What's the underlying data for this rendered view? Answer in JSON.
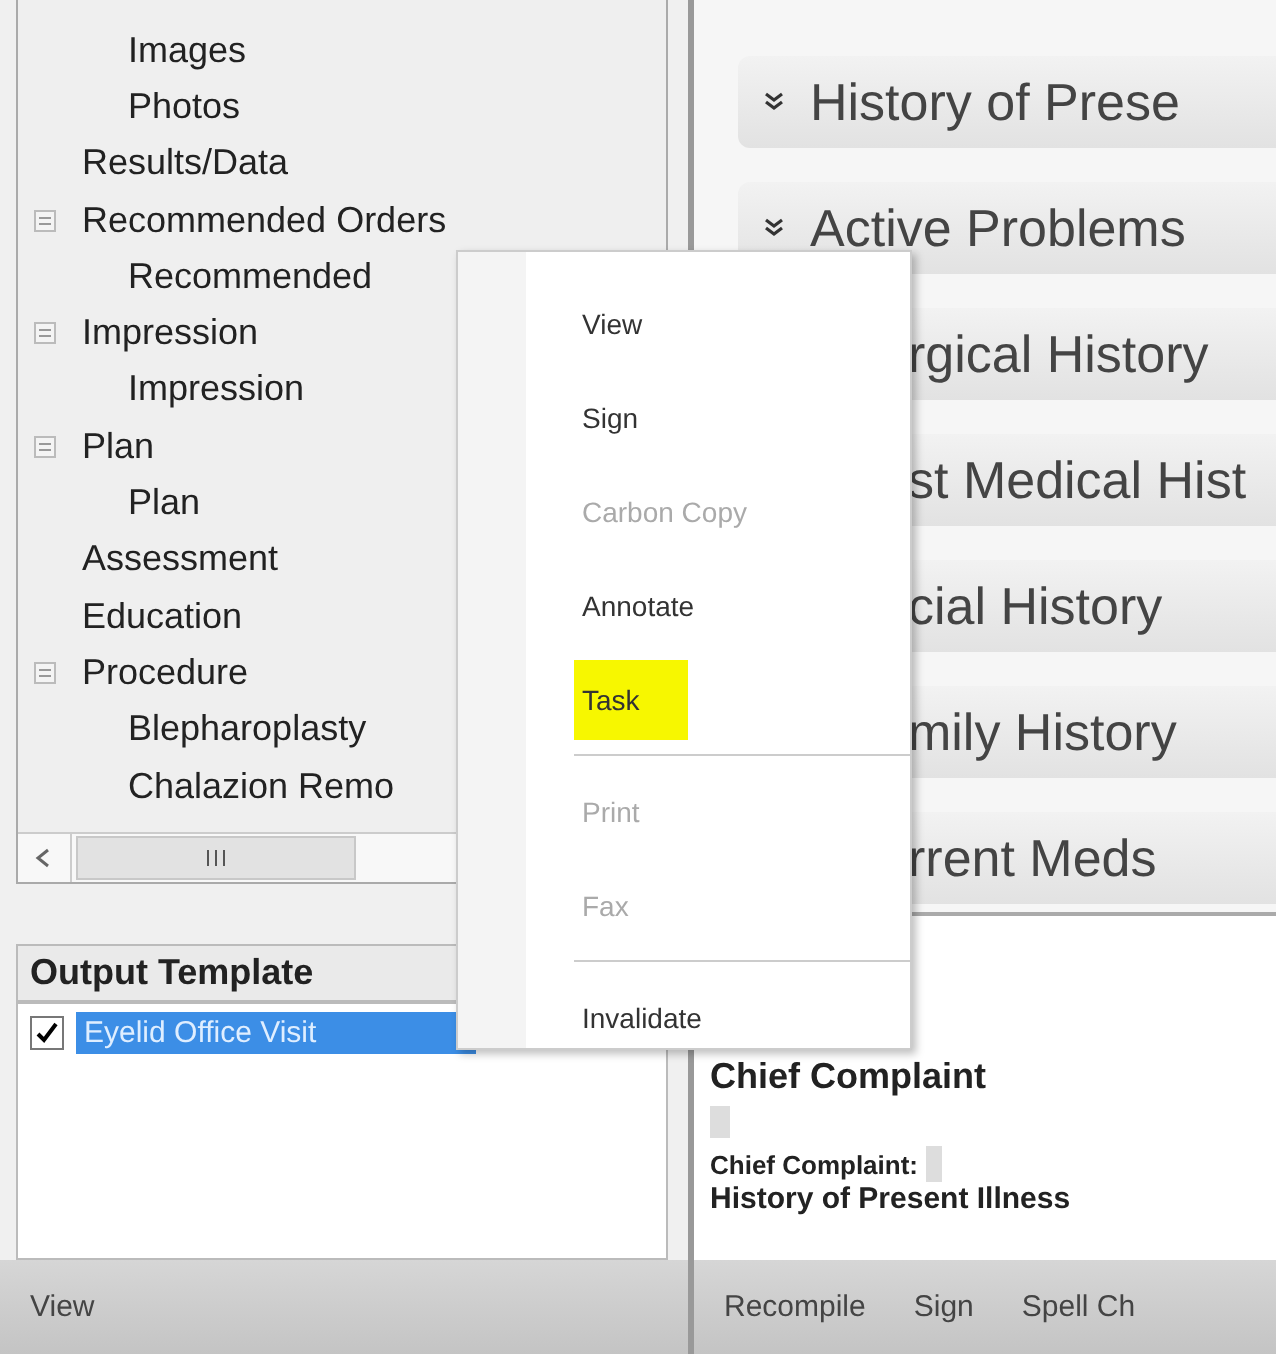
{
  "tree": {
    "items": [
      {
        "children": [
          {
            "label": "Images"
          },
          {
            "label": "Photos"
          }
        ]
      },
      {
        "label": "Results/Data"
      },
      {
        "label": "Recommended Orders",
        "expanded": true,
        "children": [
          {
            "label": "Recommended"
          }
        ]
      },
      {
        "label": "Impression",
        "expanded": true,
        "children": [
          {
            "label": "Impression"
          }
        ]
      },
      {
        "label": "Plan",
        "expanded": true,
        "children": [
          {
            "label": "Plan"
          }
        ]
      },
      {
        "label": "Assessment"
      },
      {
        "label": "Education"
      },
      {
        "label": "Procedure",
        "expanded": true,
        "children": [
          {
            "label": "Blepharoplasty"
          },
          {
            "label": "Chalazion Remo"
          }
        ]
      }
    ]
  },
  "output_template": {
    "title": "Output Template",
    "rows": [
      {
        "label": "Eyelid Office Visit",
        "checked": true,
        "selected": true
      }
    ]
  },
  "sections": [
    {
      "label": "History of Prese",
      "kind": "collapsible"
    },
    {
      "label": "Active Problems",
      "kind": "collapsible"
    },
    {
      "label": "rgical History",
      "kind": "covered"
    },
    {
      "label": "st Medical Hist",
      "kind": "covered"
    },
    {
      "label": "cial History",
      "kind": "covered"
    },
    {
      "label": "mily History",
      "kind": "covered"
    },
    {
      "label": "rrent Meds",
      "kind": "covered"
    }
  ],
  "note": {
    "heading": "Chief Complaint",
    "field_label": "Chief Complaint:",
    "next_heading": "History of Present Illness"
  },
  "left_toolbar": [
    "View"
  ],
  "right_toolbar": [
    "Recompile",
    "Sign",
    "Spell Ch"
  ],
  "context_menu": [
    {
      "kind": "item",
      "label": "View",
      "disabled": false,
      "highlighted": false
    },
    {
      "kind": "item",
      "label": "Sign",
      "disabled": false,
      "highlighted": false
    },
    {
      "kind": "item",
      "label": "Carbon Copy",
      "disabled": true,
      "highlighted": false
    },
    {
      "kind": "item",
      "label": "Annotate",
      "disabled": false,
      "highlighted": false
    },
    {
      "kind": "item",
      "label": "Task",
      "disabled": false,
      "highlighted": true
    },
    {
      "kind": "separator"
    },
    {
      "kind": "item",
      "label": "Print",
      "disabled": true,
      "highlighted": false
    },
    {
      "kind": "item",
      "label": "Fax",
      "disabled": true,
      "highlighted": false
    },
    {
      "kind": "separator"
    },
    {
      "kind": "item",
      "label": "Invalidate",
      "disabled": false,
      "highlighted": false
    }
  ]
}
